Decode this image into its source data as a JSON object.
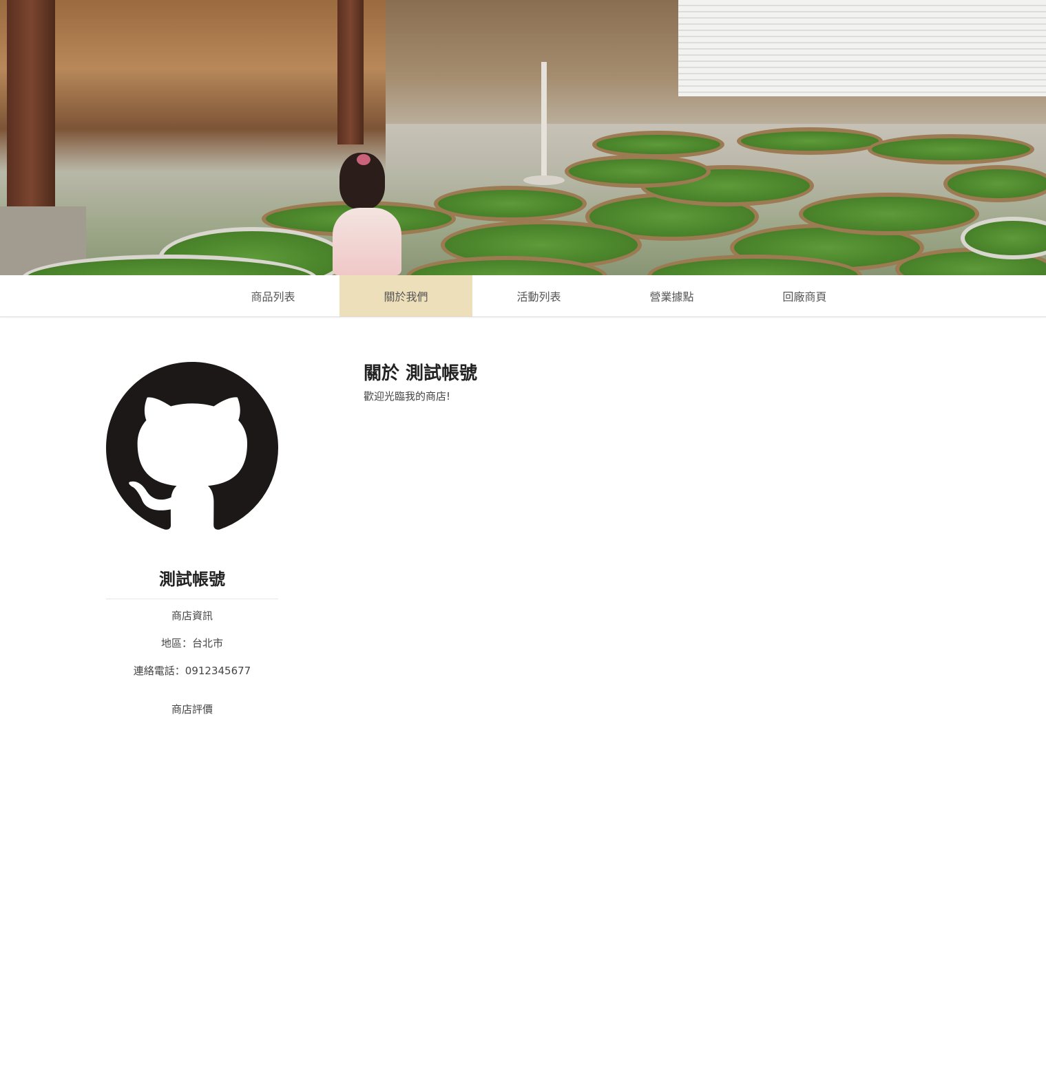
{
  "nav": {
    "items": [
      {
        "label": "商品列表",
        "active": false
      },
      {
        "label": "關於我們",
        "active": true
      },
      {
        "label": "活動列表",
        "active": false
      },
      {
        "label": "營業據點",
        "active": false
      },
      {
        "label": "回廠商頁",
        "active": false
      }
    ],
    "active_color": "#ecdfb9"
  },
  "sidebar": {
    "avatar_icon": "github-octocat-icon",
    "store_name": "測試帳號",
    "info_heading": "商店資訊",
    "region": "地區：台北市",
    "phone": "連絡電話：0912345677",
    "reviews_heading": "商店評價"
  },
  "main": {
    "title": "關於 測試帳號",
    "description": "歡迎光臨我的商店!"
  }
}
